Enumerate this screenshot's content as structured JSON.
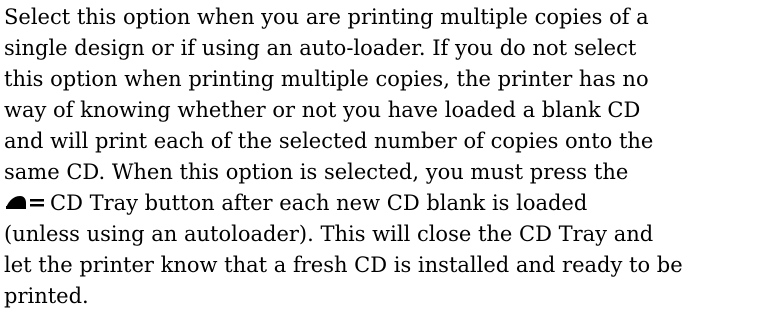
{
  "document": {
    "lines": [
      "Select this option when you are printing multiple copies of a",
      "single design or if using an auto-loader. If you do not select",
      "this option when printing multiple copies, the printer has no",
      "way of knowing whether or not you have loaded a blank CD",
      "and will print each of the selected number of copies onto the",
      "same CD. When this option is selected, you must press the",
      "CD Tray button after each new CD blank is loaded",
      "(unless using an autoloader). This will close the CD Tray and",
      "let the printer know that a fresh CD is installed and ready to be",
      "printed."
    ],
    "icon": "cd-tray-eject-icon"
  }
}
